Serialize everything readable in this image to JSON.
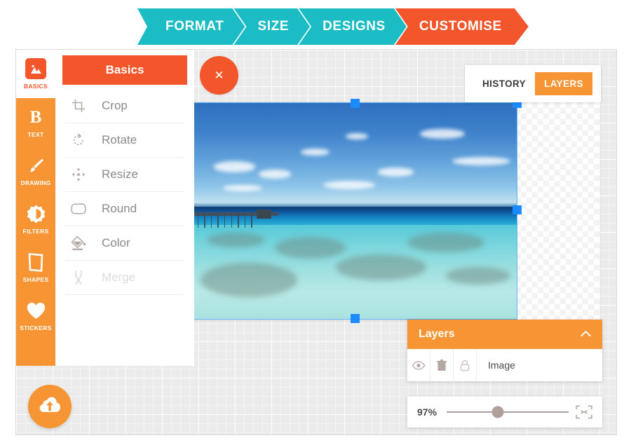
{
  "steps": {
    "items": [
      {
        "label": "FORMAT",
        "state": "done",
        "color": "#1CBCC4"
      },
      {
        "label": "SIZE",
        "state": "done",
        "color": "#1CBCC4"
      },
      {
        "label": "DESIGNS",
        "state": "done",
        "color": "#1CBCC4"
      },
      {
        "label": "CUSTOMISE",
        "state": "current",
        "color": "#F4562B"
      }
    ]
  },
  "rail": {
    "items": [
      {
        "label": "BASICS",
        "icon": "image-icon",
        "active": true
      },
      {
        "label": "TEXT",
        "icon": "text-b-icon",
        "active": false
      },
      {
        "label": "DRAWING",
        "icon": "brush-icon",
        "active": false
      },
      {
        "label": "FILTERS",
        "icon": "contrast-icon",
        "active": false
      },
      {
        "label": "SHAPES",
        "icon": "shape-icon",
        "active": false
      },
      {
        "label": "STICKERS",
        "icon": "heart-icon",
        "active": false
      }
    ]
  },
  "panel": {
    "title": "Basics",
    "close_label": "✕",
    "menu": [
      {
        "label": "Crop",
        "icon": "crop-icon",
        "disabled": false
      },
      {
        "label": "Rotate",
        "icon": "rotate-icon",
        "disabled": false
      },
      {
        "label": "Resize",
        "icon": "resize-icon",
        "disabled": false
      },
      {
        "label": "Round",
        "icon": "round-rect-icon",
        "disabled": false
      },
      {
        "label": "Color",
        "icon": "paint-bucket-icon",
        "disabled": false
      },
      {
        "label": "Merge",
        "icon": "merge-icon",
        "disabled": true
      }
    ]
  },
  "upload": {
    "icon": "cloud-upload-icon"
  },
  "history_layers": {
    "tabs": [
      {
        "label": "HISTORY",
        "active": false
      },
      {
        "label": "LAYERS",
        "active": true
      }
    ]
  },
  "layers_panel": {
    "title": "Layers",
    "collapse_icon": "chevron-up-icon",
    "rows": [
      {
        "name": "Image",
        "visibility_icon": "eye-icon",
        "delete_icon": "trash-icon",
        "lock_icon": "lock-icon"
      }
    ]
  },
  "zoombar": {
    "value_label": "97%",
    "value": 97,
    "min": 0,
    "max": 200,
    "thumb_percent": 42,
    "fit_icon": "fit-to-screen-icon"
  },
  "canvas": {
    "image_layer_name": "Image",
    "selection_handles": [
      "top-center",
      "top-right",
      "middle-right",
      "bottom-center"
    ]
  },
  "colors": {
    "teal": "#1CBCC4",
    "orange_red": "#F4562B",
    "orange": "#F79433",
    "selection_blue": "#1A8CFF",
    "workspace_gray": "#EBEBEB"
  }
}
